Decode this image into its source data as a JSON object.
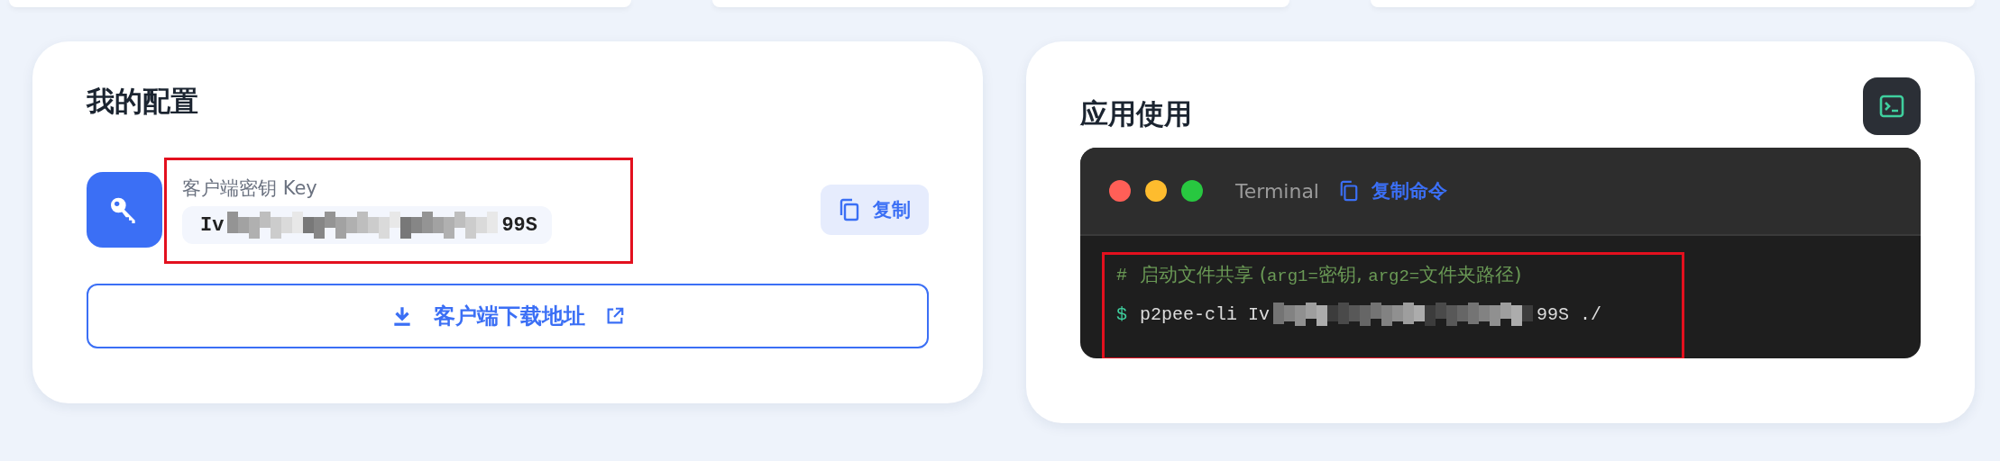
{
  "top_cards": [
    {
      "kind": "card"
    },
    {
      "kind": "card"
    },
    {
      "kind": "card"
    }
  ],
  "config": {
    "title": "我的配置",
    "key_label": "客户端密钥 Key",
    "key_start": "Iv",
    "key_end": "99S",
    "copy_button": "复制",
    "download_button": "客户端下载地址",
    "highlighted": true
  },
  "usage": {
    "title": "应用使用",
    "terminal": {
      "title": "Terminal",
      "copy_button": "复制命令",
      "comment_mark": "#",
      "comment": "启动文件共享 (",
      "comment_arg1": "arg1=",
      "comment_mid": "密钥, ",
      "comment_arg2": "arg2=",
      "comment_end": "文件夹路径)",
      "prompt": "$",
      "command": "p2pee-cli Iv",
      "command_end": "99S ./"
    },
    "highlighted": true
  }
}
